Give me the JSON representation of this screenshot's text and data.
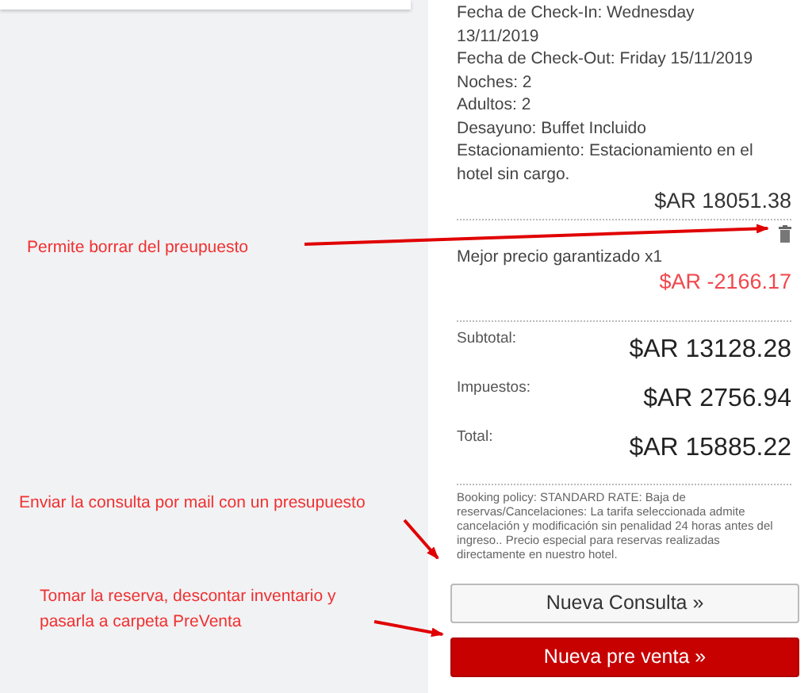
{
  "booking": {
    "details": [
      "Fecha de Check-In: Wednesday 13/11/2019",
      "Fecha de Check-Out: Friday 15/11/2019",
      "Noches: 2",
      "Adultos: 2",
      "Desayuno: Buffet Incluido",
      "Estacionamiento: Estacionamiento en el hotel sin cargo."
    ],
    "room_price": "$AR 18051.38",
    "discount": {
      "label": "Mejor precio garantizado x1",
      "amount": "$AR -2166.17"
    },
    "totals": [
      {
        "label": "Subtotal:",
        "value": "$AR 13128.28"
      },
      {
        "label": "Impuestos:",
        "value": "$AR 2756.94"
      },
      {
        "label": "Total:",
        "value": "$AR 15885.22"
      }
    ],
    "policy": "Booking policy: STANDARD RATE: Baja de reservas/Cancelaciones: La tarifa seleccionada admite cancelación y modificación sin penalidad 24 horas antes del ingreso.. Precio especial para reservas realizadas directamente en nuestro hotel.",
    "buttons": [
      {
        "label": "Nueva Consulta »",
        "kind": "secondary"
      },
      {
        "label": "Nueva pre venta »",
        "kind": "primary"
      }
    ]
  },
  "annotations": [
    {
      "text": "Permite borrar del preupuesto"
    },
    {
      "text": "Enviar la consulta por mail con un presupuesto"
    },
    {
      "text": "Tomar la reserva, descontar inventario y pasarla a carpeta PreVenta"
    }
  ]
}
